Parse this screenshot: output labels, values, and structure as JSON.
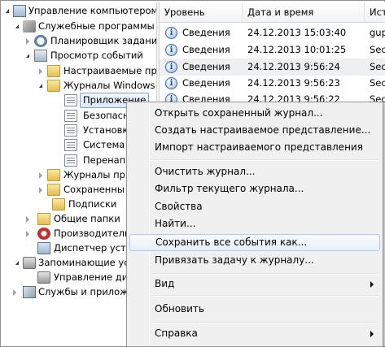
{
  "tree": {
    "items": [
      {
        "label": "Управление компьютером (л",
        "icon": "computer-icon",
        "expander": "open"
      },
      {
        "label": "Служебные программы",
        "icon": "tools-icon",
        "expander": "open"
      },
      {
        "label": "Планировщик заданий",
        "icon": "clock-icon",
        "expander": "closed"
      },
      {
        "label": "Просмотр событий",
        "icon": "event-viewer-icon",
        "expander": "open"
      },
      {
        "label": "Настраиваемые пр",
        "icon": "folder-icon",
        "expander": "closed"
      },
      {
        "label": "Журналы Windows",
        "icon": "folder-icon",
        "expander": "open"
      },
      {
        "label": "Приложение",
        "icon": "log-icon",
        "expander": "none",
        "selected": true
      },
      {
        "label": "Безопасн",
        "icon": "log-icon",
        "expander": "none"
      },
      {
        "label": "Установка",
        "icon": "log-icon",
        "expander": "none"
      },
      {
        "label": "Система",
        "icon": "log-icon",
        "expander": "none"
      },
      {
        "label": "Перенапр",
        "icon": "log-icon",
        "expander": "none"
      },
      {
        "label": "Журналы пр",
        "icon": "folder-icon",
        "expander": "closed"
      },
      {
        "label": "Сохраненны",
        "icon": "folder-icon",
        "expander": "closed"
      },
      {
        "label": "Подписки",
        "icon": "folder-icon",
        "expander": "none"
      },
      {
        "label": "Общие папки",
        "icon": "shared-folder-icon",
        "expander": "closed"
      },
      {
        "label": "Производитель",
        "icon": "performance-icon",
        "expander": "closed"
      },
      {
        "label": "Диспетчер устро",
        "icon": "device-manager-icon",
        "expander": "none"
      },
      {
        "label": "Запоминающие уст",
        "icon": "storage-icon",
        "expander": "open"
      },
      {
        "label": "Управление дис",
        "icon": "disk-icon",
        "expander": "none"
      },
      {
        "label": "Службы и приложе",
        "icon": "services-icon",
        "expander": "closed"
      }
    ]
  },
  "list": {
    "columns": [
      "Уровень",
      "Дата и время",
      "Ист"
    ],
    "rows": [
      {
        "level": "Сведения",
        "datetime": "24.12.2013 15:03:40",
        "source": "gup"
      },
      {
        "level": "Сведения",
        "datetime": "24.12.2013 10:01:25",
        "source": "Sec"
      },
      {
        "level": "Сведения",
        "datetime": "24.12.2013 9:56:24",
        "source": "Sec"
      },
      {
        "level": "Сведения",
        "datetime": "24.12.2013 9:56:23",
        "source": "Sec"
      },
      {
        "level": "Сведения",
        "datetime": "24.12.2013 9:56:22",
        "source": "Sec"
      }
    ]
  },
  "menu": {
    "items": [
      {
        "label": "Открыть сохраненный журнал..."
      },
      {
        "label": "Создать настраиваемое представление..."
      },
      {
        "label": "Импорт настраиваемого представления"
      },
      {
        "label": "Очистить журнал..."
      },
      {
        "label": "Фильтр текущего журнала..."
      },
      {
        "label": "Свойства"
      },
      {
        "label": "Найти..."
      },
      {
        "label": "Сохранить все события как...",
        "hover": true
      },
      {
        "label": "Привязать задачу к журналу..."
      },
      {
        "label": "Вид",
        "submenu": true
      },
      {
        "label": "Обновить"
      },
      {
        "label": "Справка",
        "submenu": true
      }
    ]
  }
}
